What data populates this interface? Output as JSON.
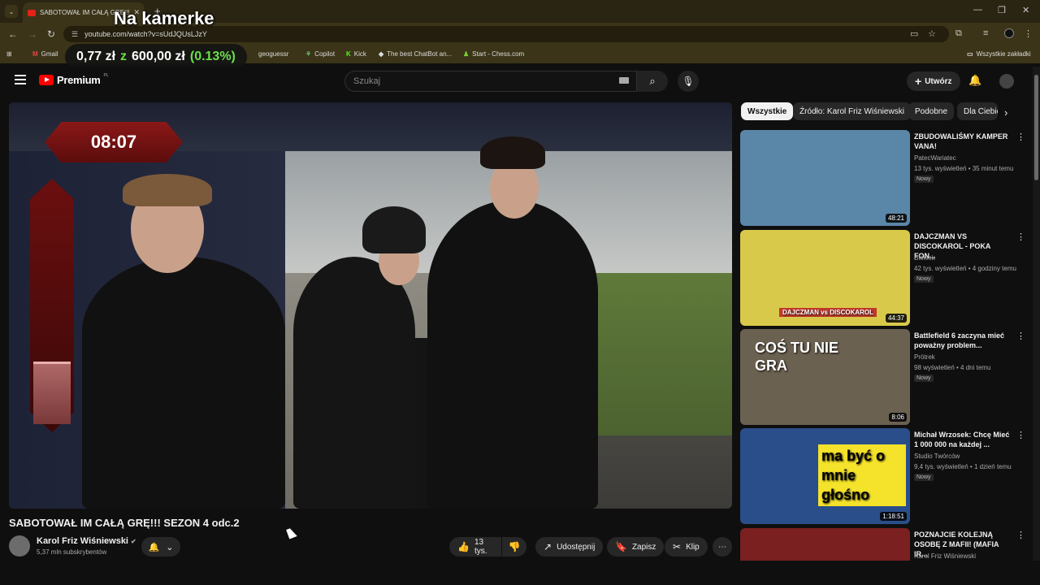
{
  "browser": {
    "tab_title": "SABOTOWAŁ IM CAŁĄ GRĘ!!!",
    "url": "youtube.com/watch?v=sUdJQUsLJzY",
    "bookmarks": [
      {
        "label": "Gmail"
      },
      {
        "label": "geoguessr"
      },
      {
        "label": "Copilot"
      },
      {
        "label": "Kick"
      },
      {
        "label": "The best ChatBot an..."
      },
      {
        "label": "Start - Chess.com"
      }
    ],
    "all_bookmarks": "Wszystkie zakładki"
  },
  "overlay": {
    "camera_label": "Na kamerke",
    "money_current": "0,77 zł",
    "money_of": "z",
    "money_goal": "600,00 zł",
    "money_pct": "(0.13%)"
  },
  "youtube": {
    "logo_text": "Premium",
    "logo_region": "PL",
    "search_placeholder": "Szukaj",
    "create_label": "Utwórz"
  },
  "player": {
    "timer": "08:07",
    "gauge_level": 0.28
  },
  "video": {
    "title": "SABOTOWAŁ IM CAŁĄ GRĘ!!! SEZON 4 odc.2",
    "channel": "Karol Friz Wiśniewski",
    "subscribers": "5,37 mln subskrybentów",
    "likes": "13 tys.",
    "share_label": "Udostępnij",
    "save_label": "Zapisz",
    "clip_label": "Klip"
  },
  "sidebar": {
    "chips": [
      "Wszystkie",
      "Źródło: Karol Friz Wiśniewski",
      "Podobne",
      "Dla Ciebie"
    ],
    "recommendations": [
      {
        "title": "ZBUDOWALIŚMY KAMPER VANA!",
        "channel": "PatecWariatec",
        "meta": "13 tys. wyświetleń • 35 minut temu",
        "badge": "Nowy",
        "duration": "48:21",
        "color": "#5a86a8",
        "thumb_text": ""
      },
      {
        "title": "DAJCZMAN VS DISCOKAROL - POKA FON...",
        "channel": "Blowek",
        "meta": "42 tys. wyświetleń • 4 godziny temu",
        "badge": "Nowy",
        "duration": "44:37",
        "color": "#d8c94a",
        "thumb_text": "DAJCZMAN vs DISCOKAROL"
      },
      {
        "title": "Battlefield 6 zaczyna mieć poważny problem...",
        "channel": "Prötrek",
        "meta": "98 wyświetleń • 4 dni temu",
        "badge": "Nowy",
        "duration": "8:06",
        "color": "#6b6150",
        "thumb_text": "COŚ TU NIE GRA"
      },
      {
        "title": "Michał Wrzosek: Chcę Mieć 1 000 000 na każdej ...",
        "channel": "Studio Twórców",
        "meta": "9,4 tys. wyświetleń • 1 dzień temu",
        "badge": "Nowy",
        "duration": "1:18:51",
        "color": "#2a4e8a",
        "thumb_text": "ma być o mnie głośno"
      },
      {
        "title": "POZNAJCIE KOLEJNĄ OSOBĘ Z MAFII! (MAFIA IR...",
        "channel": "Karol Friz Wiśniewski",
        "meta": "",
        "badge": "",
        "duration": "",
        "color": "#7a2020",
        "thumb_text": ""
      }
    ]
  }
}
